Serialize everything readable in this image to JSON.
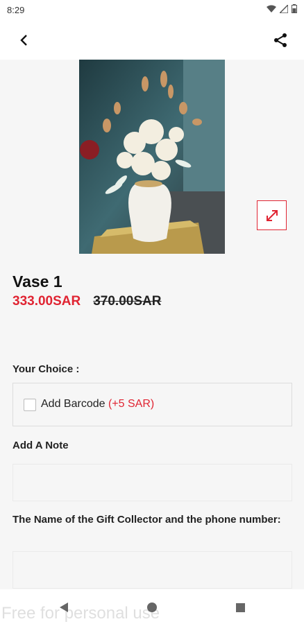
{
  "status_bar": {
    "time": "8:29"
  },
  "product": {
    "title": "Vase 1",
    "price": "333.00SAR",
    "old_price": "370.00SAR"
  },
  "options": {
    "choice_label": "Your Choice :",
    "barcode_label": "Add Barcode",
    "barcode_extra": "(+5 SAR)",
    "barcode_checked": false
  },
  "note": {
    "label": "Add A Note",
    "value": ""
  },
  "collector": {
    "label": "The Name of the Gift Collector and the phone number:",
    "value": ""
  },
  "watermark": "Free for personal use",
  "colors": {
    "accent": "#e02432",
    "background": "#f6f6f6"
  },
  "icons": [
    "back-arrow-icon",
    "share-icon",
    "expand-icon",
    "checkbox-icon",
    "nav-back-icon",
    "nav-home-icon",
    "nav-recents-icon"
  ]
}
